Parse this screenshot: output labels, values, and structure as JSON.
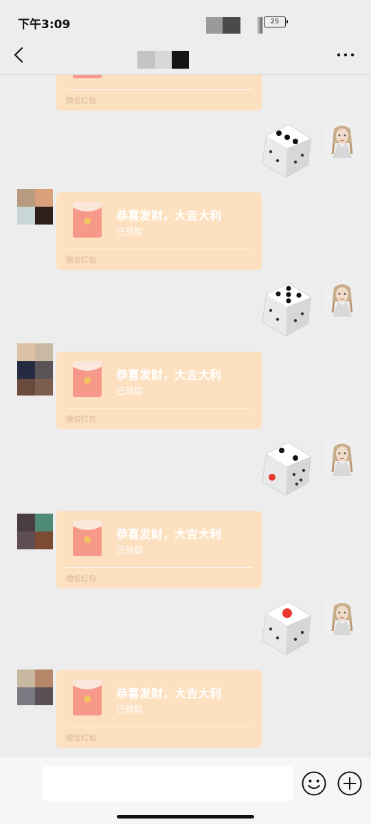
{
  "status_bar": {
    "time": "下午3:09",
    "battery_level": "25"
  },
  "messages": [
    {
      "type": "red_packet",
      "side": "left",
      "partial": true,
      "title": "",
      "status": "",
      "footer": "微信红包"
    },
    {
      "type": "dice",
      "side": "right",
      "face": 3
    },
    {
      "type": "red_packet",
      "side": "left",
      "title": "恭喜发财，大吉大利",
      "status": "已领取",
      "footer": "微信红包"
    },
    {
      "type": "dice",
      "side": "right",
      "face": 5
    },
    {
      "type": "red_packet",
      "side": "left",
      "title": "恭喜发财，大吉大利",
      "status": "已领取",
      "footer": "微信红包"
    },
    {
      "type": "dice",
      "side": "right",
      "face": 2
    },
    {
      "type": "red_packet",
      "side": "left",
      "title": "恭喜发财，大吉大利",
      "status": "已领取",
      "footer": "微信红包"
    },
    {
      "type": "dice",
      "side": "right",
      "face": 1
    },
    {
      "type": "red_packet",
      "side": "left",
      "title": "恭喜发财，大吉大利",
      "status": "已领取",
      "footer": "微信红包"
    }
  ],
  "icons": {
    "back": "back-arrow-icon",
    "more": "more-dots-icon",
    "emoji": "emoji-icon",
    "plus": "plus-icon"
  },
  "colors": {
    "background": "#ededed",
    "red_packet_bubble": "#fce0c0",
    "red_packet_envelope": "#f7998a",
    "dice_one_pip": "#e8382f"
  }
}
